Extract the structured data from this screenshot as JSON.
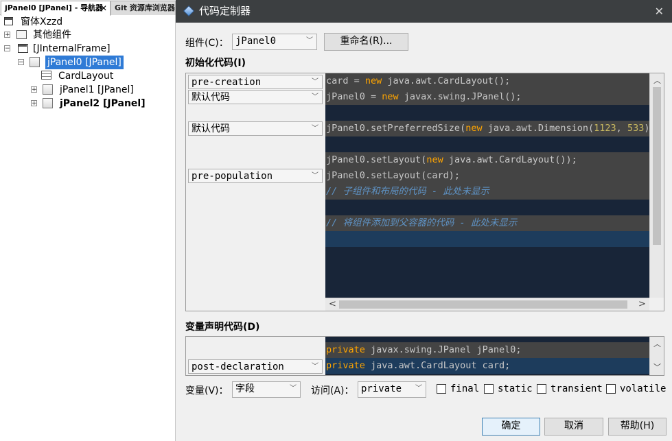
{
  "navigator": {
    "tabs": [
      {
        "label": "jPanel0 [JPanel] - 导航器",
        "close": "✕"
      },
      {
        "label": "Git 资源库浏览器"
      }
    ],
    "tree": {
      "form": "窗体Xzzd",
      "other": "其他组件",
      "internal_frame": "[JInternalFrame]",
      "jpanel0": "jPanel0 [JPanel]",
      "cardlayout": "CardLayout",
      "jpanel1": "jPanel1 [JPanel]",
      "jpanel2": "jPanel2 [JPanel]"
    }
  },
  "dialog": {
    "title": "代码定制器",
    "close": "✕",
    "component_label": "组件(C)：",
    "component_value": "jPanel0",
    "rename_button": "重命名(R)...",
    "init_title": "初始化代码(I)",
    "init_combos": [
      "pre-creation",
      "默认代码",
      "默认代码",
      "pre-population"
    ],
    "code_lines": [
      [
        "card = ",
        "new",
        " java.awt.CardLayout();"
      ],
      [
        "jPanel0 = ",
        "new",
        " javax.swing.JPanel();"
      ],
      [],
      [
        "jPanel0.setPreferredSize(",
        "new",
        " java.awt.Dimension(",
        "1123",
        ", ",
        "533",
        "))"
      ],
      [],
      [
        "jPanel0.setLayout(",
        "new",
        " java.awt.CardLayout());"
      ],
      [
        "jPanel0.setLayout(card);"
      ],
      [
        "// 子组件和布局的代码 - 此处未显示"
      ],
      [],
      [
        "// 将组件添加到父容器的代码 - 此处未显示"
      ],
      []
    ],
    "decl_title": "变量声明代码(D)",
    "decl_combo": "post-declaration",
    "decl_lines": [
      [
        "private",
        " javax.swing.JPanel jPanel0;"
      ],
      [
        "private",
        " java.awt.CardLayout card;"
      ]
    ],
    "variable_label": "变量(V)：",
    "variable_value": "字段",
    "access_label": "访问(A)：",
    "access_value": "private",
    "checkboxes": [
      "final",
      "static",
      "transient",
      "volatile"
    ],
    "ok_button": "确定",
    "cancel_button": "取消",
    "help_button": "帮助(H)"
  }
}
